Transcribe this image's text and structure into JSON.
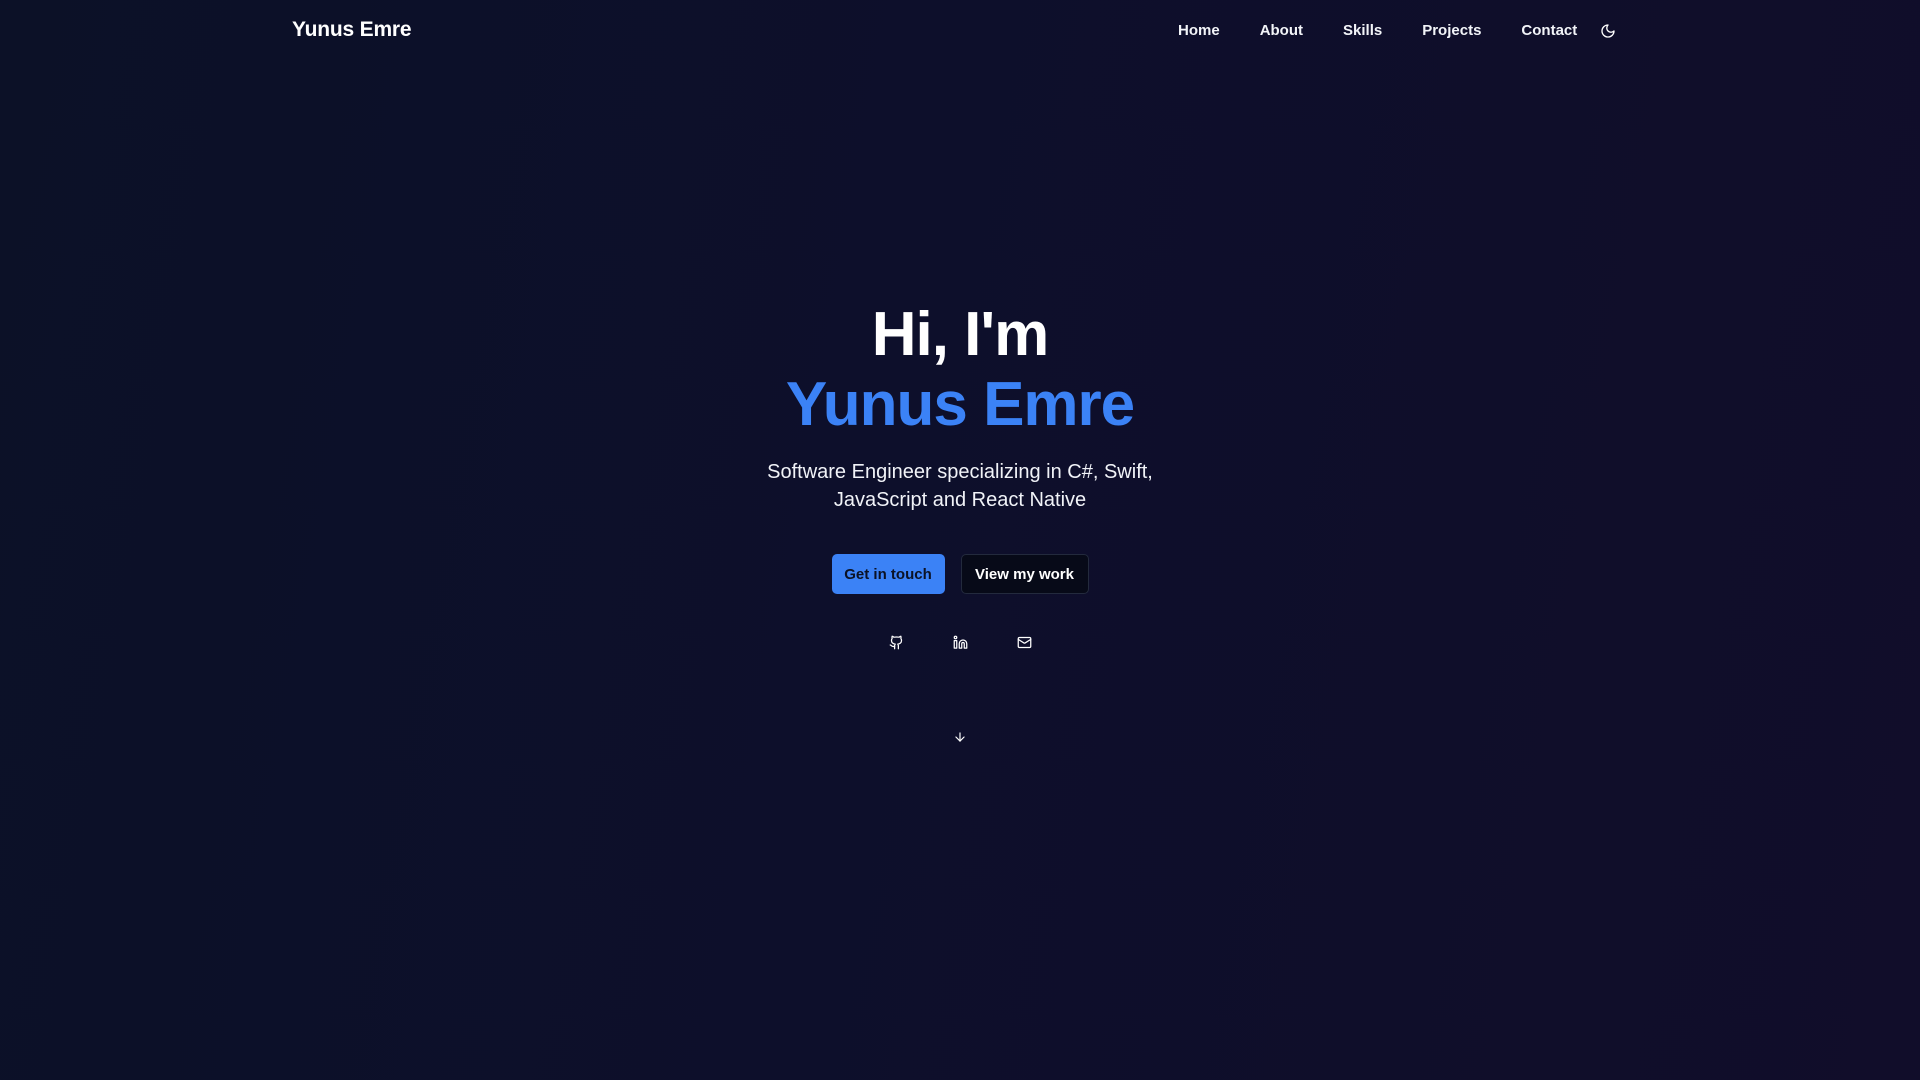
{
  "header": {
    "brand": "Yunus Emre",
    "nav": [
      {
        "label": "Home"
      },
      {
        "label": "About"
      },
      {
        "label": "Skills"
      },
      {
        "label": "Projects"
      },
      {
        "label": "Contact"
      }
    ],
    "theme_toggle_icon": "moon-icon"
  },
  "hero": {
    "greeting": "Hi, I'm",
    "name": "Yunus Emre",
    "subtitle": "Software Engineer specializing in C#, Swift, JavaScript and React Native",
    "primary_button": "Get in touch",
    "secondary_button": "View my work",
    "socials": [
      {
        "icon": "github-icon"
      },
      {
        "icon": "linkedin-icon"
      },
      {
        "icon": "mail-icon"
      }
    ],
    "scroll_icon": "arrow-down-icon"
  },
  "colors": {
    "accent": "#3b82f6",
    "background": "#0d0f2b",
    "text": "#ffffff"
  }
}
